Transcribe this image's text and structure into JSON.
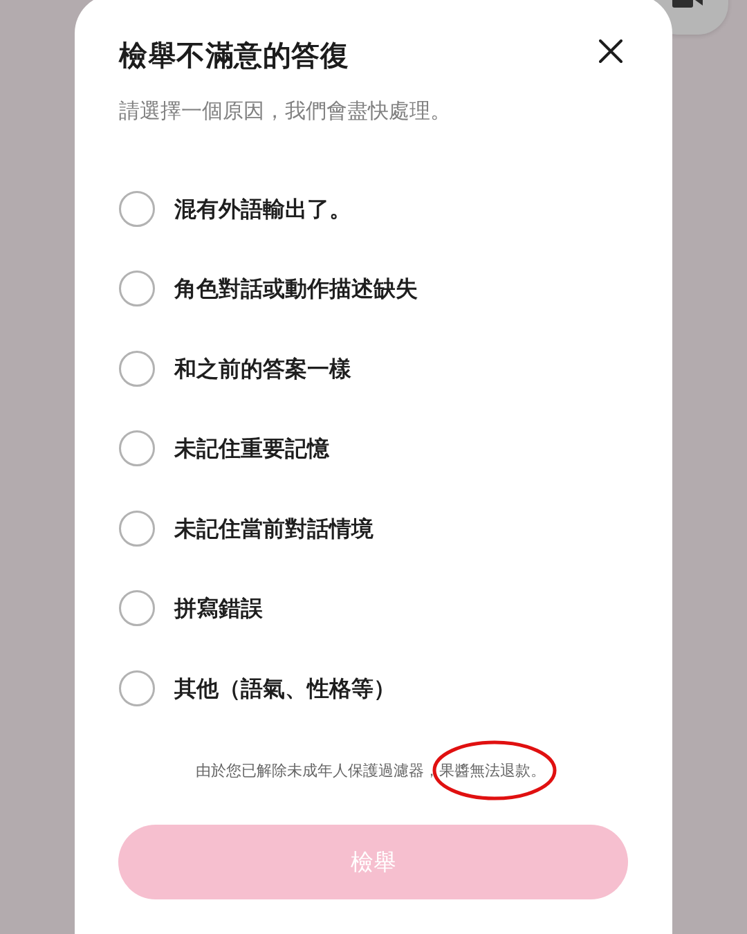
{
  "dialog": {
    "title": "檢舉不滿意的答復",
    "subtitle": "請選擇一個原因，我們會盡快處理。"
  },
  "reasons": [
    {
      "label": "混有外語輸出了。",
      "selected": false
    },
    {
      "label": "角色對話或動作描述缺失",
      "selected": false
    },
    {
      "label": "和之前的答案一樣",
      "selected": false
    },
    {
      "label": "未記住重要記憶",
      "selected": false
    },
    {
      "label": "未記住當前對話情境",
      "selected": false
    },
    {
      "label": "拼寫錯誤",
      "selected": false
    },
    {
      "label": "其他（語氣、性格等）",
      "selected": false
    }
  ],
  "note": [
    {
      "text": "由於您已解除未成年人保護過濾器，",
      "circled": false
    },
    {
      "text": "果醬無法退款。",
      "circled": true
    }
  ],
  "submit_button": {
    "label": "檢舉",
    "disabled": true
  }
}
